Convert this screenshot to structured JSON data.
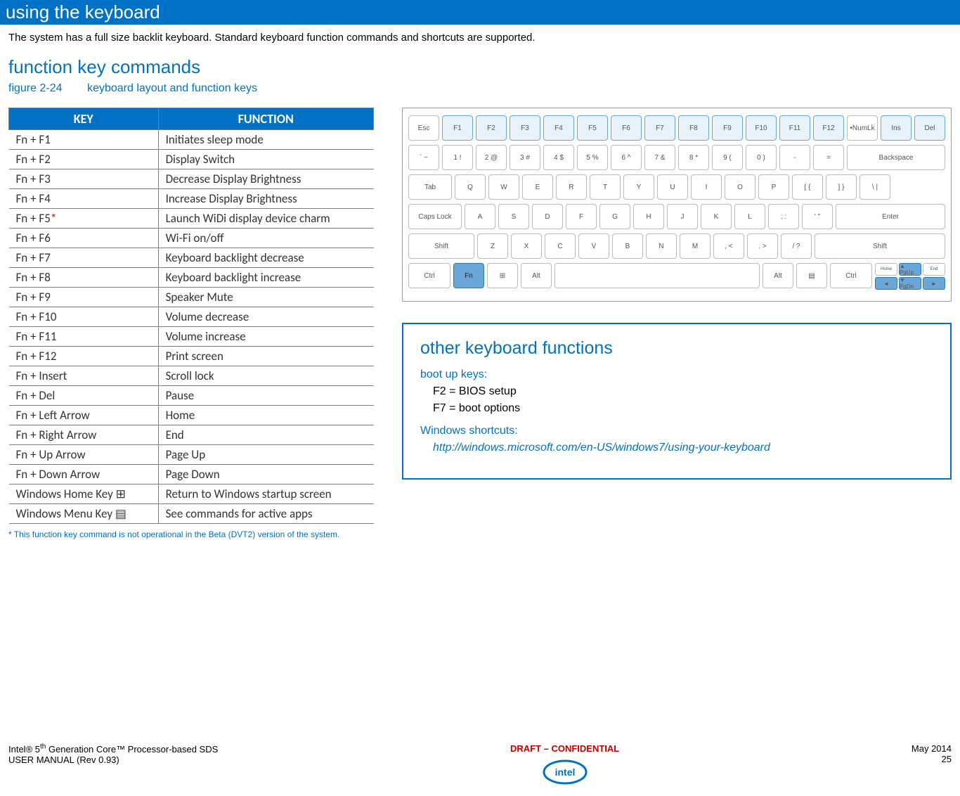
{
  "banner": "using the keyboard",
  "intro": "The system has a full size backlit keyboard.  Standard keyboard function commands and shortcuts are supported.",
  "section_heading": "function key commands",
  "figure_label_a": "figure 2-24",
  "figure_label_b": "keyboard layout and function keys",
  "table": {
    "head_key": "KEY",
    "head_fn": "FUNCTION",
    "rows": [
      {
        "k": "Fn + F1",
        "f": "Initiates sleep mode"
      },
      {
        "k": "Fn + F2",
        "f": "Display Switch"
      },
      {
        "k": "Fn + F3",
        "f": "Decrease Display Brightness"
      },
      {
        "k": "Fn + F4",
        "f": "Increase Display Brightness"
      },
      {
        "k": "Fn + F5",
        "star": "*",
        "f": "Launch WiDi display device charm"
      },
      {
        "k": "Fn + F6",
        "f": "Wi-Fi on/off"
      },
      {
        "k": "Fn + F7",
        "f": "Keyboard backlight decrease"
      },
      {
        "k": "Fn + F8",
        "f": "Keyboard backlight increase"
      },
      {
        "k": "Fn + F9",
        "f": "Speaker Mute"
      },
      {
        "k": "Fn + F10",
        "f": "Volume decrease"
      },
      {
        "k": "Fn + F11",
        "f": "Volume increase"
      },
      {
        "k": "Fn + F12",
        "f": "Print screen"
      },
      {
        "k": "Fn + Insert",
        "f": "Scroll lock"
      },
      {
        "k": "Fn + Del",
        "f": "Pause"
      },
      {
        "k": "Fn + Left Arrow",
        "f": "Home"
      },
      {
        "k": "Fn + Right Arrow",
        "f": "End"
      },
      {
        "k": "Fn + Up Arrow",
        "f": "Page Up"
      },
      {
        "k": "Fn + Down Arrow",
        "f": "Page Down"
      },
      {
        "k": "Windows Home Key ⊞",
        "f": "Return to Windows startup screen"
      },
      {
        "k": "Windows Menu Key  ▤",
        "f": "See commands for active apps"
      }
    ]
  },
  "footnote": "*  This function key command is not operational in the Beta (DVT2) version of the system.",
  "kbd_row1": [
    "Esc",
    "F1",
    "F2",
    "F3",
    "F4",
    "F5",
    "F6",
    "F7",
    "F8",
    "F9",
    "F10",
    "F11",
    "F12",
    "•NumLk",
    "Ins",
    "Del"
  ],
  "kbd_row2": [
    "` ~",
    "1 !",
    "2 @",
    "3 #",
    "4 $",
    "5 %",
    "6 ^",
    "7 &",
    "8 *",
    "9 (",
    "0 )",
    "-",
    "=",
    "Backspace"
  ],
  "kbd_row3": [
    "Tab",
    "Q",
    "W",
    "E",
    "R",
    "T",
    "Y",
    "U",
    "I",
    "O",
    "P",
    "[ {",
    "] }",
    "\\ |"
  ],
  "kbd_row4": [
    "Caps Lock",
    "A",
    "S",
    "D",
    "F",
    "G",
    "H",
    "J",
    "K",
    "L",
    "; :",
    "' \"",
    "Enter"
  ],
  "kbd_row5": [
    "Shift",
    "Z",
    "X",
    "C",
    "V",
    "B",
    "N",
    "M",
    ", <",
    ". >",
    "/ ?",
    "Shift"
  ],
  "kbd_row6": [
    "Ctrl",
    "Fn",
    "⊞",
    "Alt",
    "",
    "Alt",
    "▤",
    "Ctrl"
  ],
  "obox": {
    "title": "other keyboard functions",
    "boot_label": "boot up keys:",
    "boot1": "F2 = BIOS setup",
    "boot2": "F7 = boot options",
    "win_label": "Windows shortcuts:",
    "link": "http://windows.microsoft.com/en-US/windows7/using-your-keyboard"
  },
  "footer": {
    "left1": "Intel® 5th Generation Core™ Processor-based SDS",
    "left2": "USER MANUAL (Rev 0.93)",
    "mid": "DRAFT – CONFIDENTIAL",
    "right1": "May 2014",
    "right2": "25"
  }
}
